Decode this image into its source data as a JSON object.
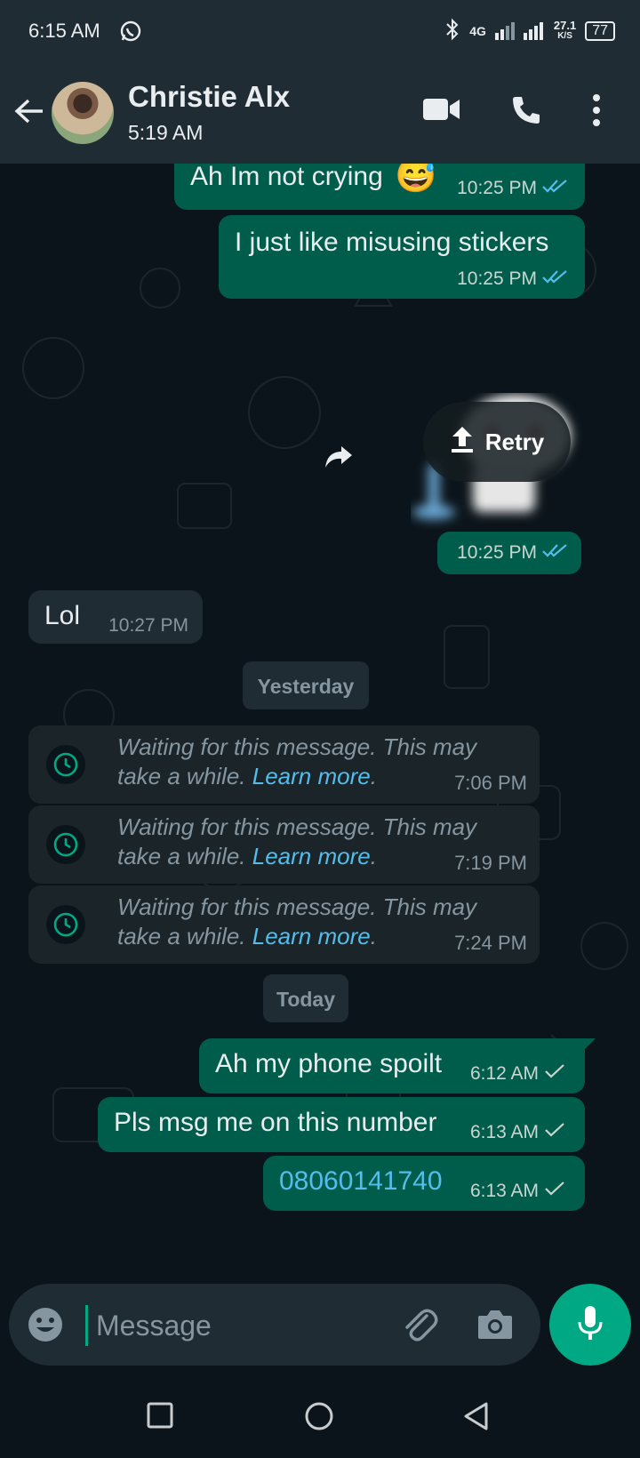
{
  "status_bar": {
    "time": "6:15 AM",
    "network": "4G",
    "speed": "27.1",
    "speed_unit": "K/S",
    "battery": "77"
  },
  "header": {
    "name": "Christie Alx",
    "status": "5:19 AM"
  },
  "messages": {
    "m1": {
      "text": "Ah Im not crying",
      "emoji": "😅",
      "time": "10:25 PM"
    },
    "m2": {
      "text": "I just like misusing stickers",
      "time": "10:25 PM"
    },
    "sticker": {
      "retry_label": "Retry",
      "time": "10:25 PM"
    },
    "m3": {
      "text": "Lol",
      "time": "10:27 PM"
    },
    "date_yesterday": "Yesterday",
    "waiting": [
      {
        "text": "Waiting for this message. This may take a while.",
        "link": "Learn more",
        "time": "7:06 PM"
      },
      {
        "text": "Waiting for this message. This may take a while.",
        "link": "Learn more",
        "time": "7:19 PM"
      },
      {
        "text": "Waiting for this message. This may take a while.",
        "link": "Learn more",
        "time": "7:24 PM"
      }
    ],
    "date_today": "Today",
    "m4": {
      "text": "Ah my phone spoilt",
      "time": "6:12 AM"
    },
    "m5": {
      "text": "Pls msg me on this number",
      "time": "6:13 AM"
    },
    "m6": {
      "text": "08060141740",
      "time": "6:13 AM"
    }
  },
  "composer": {
    "placeholder": "Message"
  },
  "colors": {
    "accent": "#00a884",
    "outgoing_bubble": "#005c4b",
    "link": "#53bdeb"
  }
}
